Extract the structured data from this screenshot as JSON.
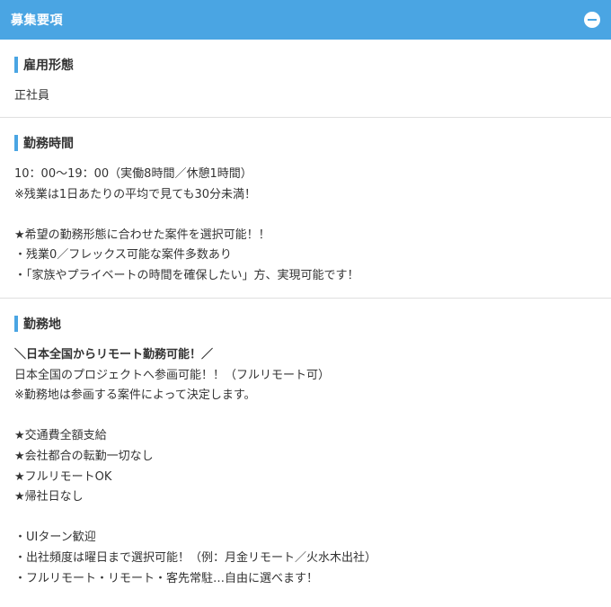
{
  "header": {
    "title": "募集要項",
    "collapse_icon": "minus-circle-icon"
  },
  "sections": {
    "employment": {
      "heading": "雇用形態",
      "lines": [
        "正社員"
      ]
    },
    "hours": {
      "heading": "勤務時間",
      "lines": [
        "10：00〜19：00（実働8時間／休憩1時間）",
        "※残業は1日あたりの平均で見ても30分未満！",
        "",
        "★希望の勤務形態に合わせた案件を選択可能！！",
        "・残業0／フレックス可能な案件多数あり",
        "・「家族やプライベートの時間を確保したい」方、実現可能です！"
      ]
    },
    "location": {
      "heading": "勤務地",
      "lead": "＼日本全国からリモート勤務可能！／",
      "lines": [
        "日本全国のプロジェクトへ参画可能！！（フルリモート可）",
        "※勤務地は参画する案件によって決定します。",
        "",
        "★交通費全額支給",
        "★会社都合の転勤一切なし",
        "★フルリモートOK",
        "★帰社日なし",
        "",
        "・UIターン歓迎",
        "・出社頻度は曜日まで選択可能！（例：月金リモート／火水木出社）",
        "・フルリモート・リモート・客先常駐…自由に選べます！"
      ]
    }
  },
  "colors": {
    "accent": "#4aa5e3",
    "text": "#333333",
    "divider": "#e0e0e0"
  }
}
